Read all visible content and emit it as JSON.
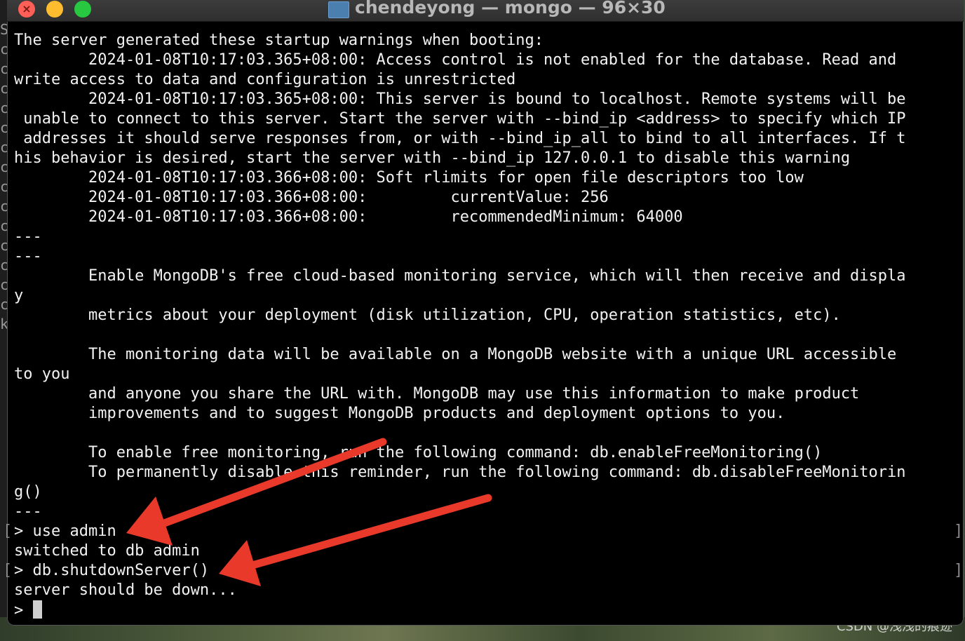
{
  "window": {
    "title": "chendeyong — mongo — 96×30",
    "close_glyph": "×"
  },
  "left_window_glyphs": [
    "S",
    "c",
    "c",
    "c",
    "c",
    "c",
    "c",
    "c",
    "c",
    "c",
    "c",
    "c",
    "c",
    "c",
    "c",
    "k"
  ],
  "terminal": {
    "lines": [
      "The server generated these startup warnings when booting:",
      "        2024-01-08T10:17:03.365+08:00: Access control is not enabled for the database. Read and",
      "write access to data and configuration is unrestricted",
      "        2024-01-08T10:17:03.365+08:00: This server is bound to localhost. Remote systems will be",
      " unable to connect to this server. Start the server with --bind_ip <address> to specify which IP",
      " addresses it should serve responses from, or with --bind_ip_all to bind to all interfaces. If t",
      "his behavior is desired, start the server with --bind_ip 127.0.0.1 to disable this warning",
      "        2024-01-08T10:17:03.366+08:00: Soft rlimits for open file descriptors too low",
      "        2024-01-08T10:17:03.366+08:00:         currentValue: 256",
      "        2024-01-08T10:17:03.366+08:00:         recommendedMinimum: 64000",
      "---",
      "---",
      "        Enable MongoDB's free cloud-based monitoring service, which will then receive and displa",
      "y",
      "        metrics about your deployment (disk utilization, CPU, operation statistics, etc).",
      "",
      "        The monitoring data will be available on a MongoDB website with a unique URL accessible",
      "to you",
      "        and anyone you share the URL with. MongoDB may use this information to make product",
      "        improvements and to suggest MongoDB products and deployment options to you.",
      "",
      "        To enable free monitoring, run the following command: db.enableFreeMonitoring()",
      "        To permanently disable this reminder, run the following command: db.disableFreeMonitorin",
      "g()",
      "---",
      "> use admin",
      "switched to db admin",
      "> db.shutdownServer()",
      "server should be down...",
      "> "
    ]
  },
  "annotation": {
    "arrow_color": "#e8392b"
  },
  "watermark": "CSDN @浅浅的痕迹"
}
